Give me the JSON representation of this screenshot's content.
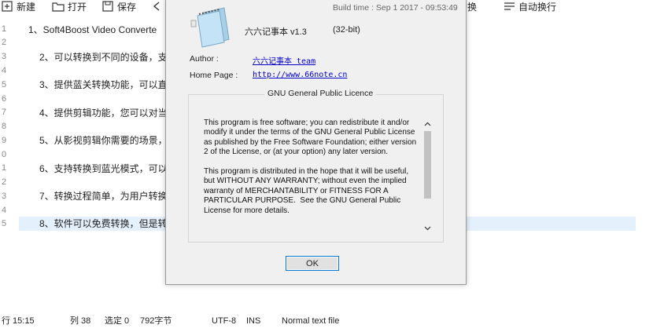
{
  "toolbar": {
    "new_label": "新建",
    "open_label": "打开",
    "save_label": "保存",
    "replace_label": "替换",
    "wrap_label": "自动换行"
  },
  "editor": {
    "line_numbers": [
      "1",
      "2",
      "3",
      "4",
      "5",
      "6",
      "7",
      "8",
      "9",
      "0",
      "1",
      "2",
      "3",
      "4",
      "5"
    ],
    "lines": [
      "1、Soft4Boost Video Converte",
      "2、可以转换到不同的设备，支",
      "3、提供蓝关转换功能，可以直",
      "4、提供剪辑功能，您可以对当",
      "5、从影视剪辑你需要的场景，",
      "6、支持转换到蓝光模式，可以",
      "7、转换过程简单，为用户转换",
      "8、软件可以免费转换，但是转"
    ]
  },
  "status": {
    "position": "行 15:15",
    "column": "列 38",
    "selection": "选定 0",
    "chars": "792字节",
    "encoding": "UTF-8",
    "mode": "INS",
    "filetype": "Normal text file"
  },
  "about": {
    "build_time": "Build time : Sep  1 2017 - 09:53:49",
    "app_name": "六六记事本 v1.3",
    "arch": "(32-bit)",
    "author_label": "Author :",
    "author_value": "六六记事本 team",
    "homepage_label": "Home Page :",
    "homepage_value": "http://www.66note.cn",
    "license_title": "GNU General Public Licence",
    "license_text": "This program is free software; you can redistribute it and/or modify it under the terms of the GNU General Public License as published by the Free Software Foundation; either version 2 of the License, or (at your option) any later version.\n\nThis program is distributed in the hope that it will be useful, but WITHOUT ANY WARRANTY; without even the implied warranty of MERCHANTABILITY or FITNESS FOR A PARTICULAR PURPOSE.  See the GNU General Public License for more details.",
    "ok_label": "OK"
  },
  "icons": [
    "new-file-icon",
    "open-folder-icon",
    "save-icon",
    "undo-icon",
    "replace-icon",
    "word-wrap-icon",
    "notepad-app-icon",
    "scroll-up-icon",
    "scroll-down-icon"
  ]
}
